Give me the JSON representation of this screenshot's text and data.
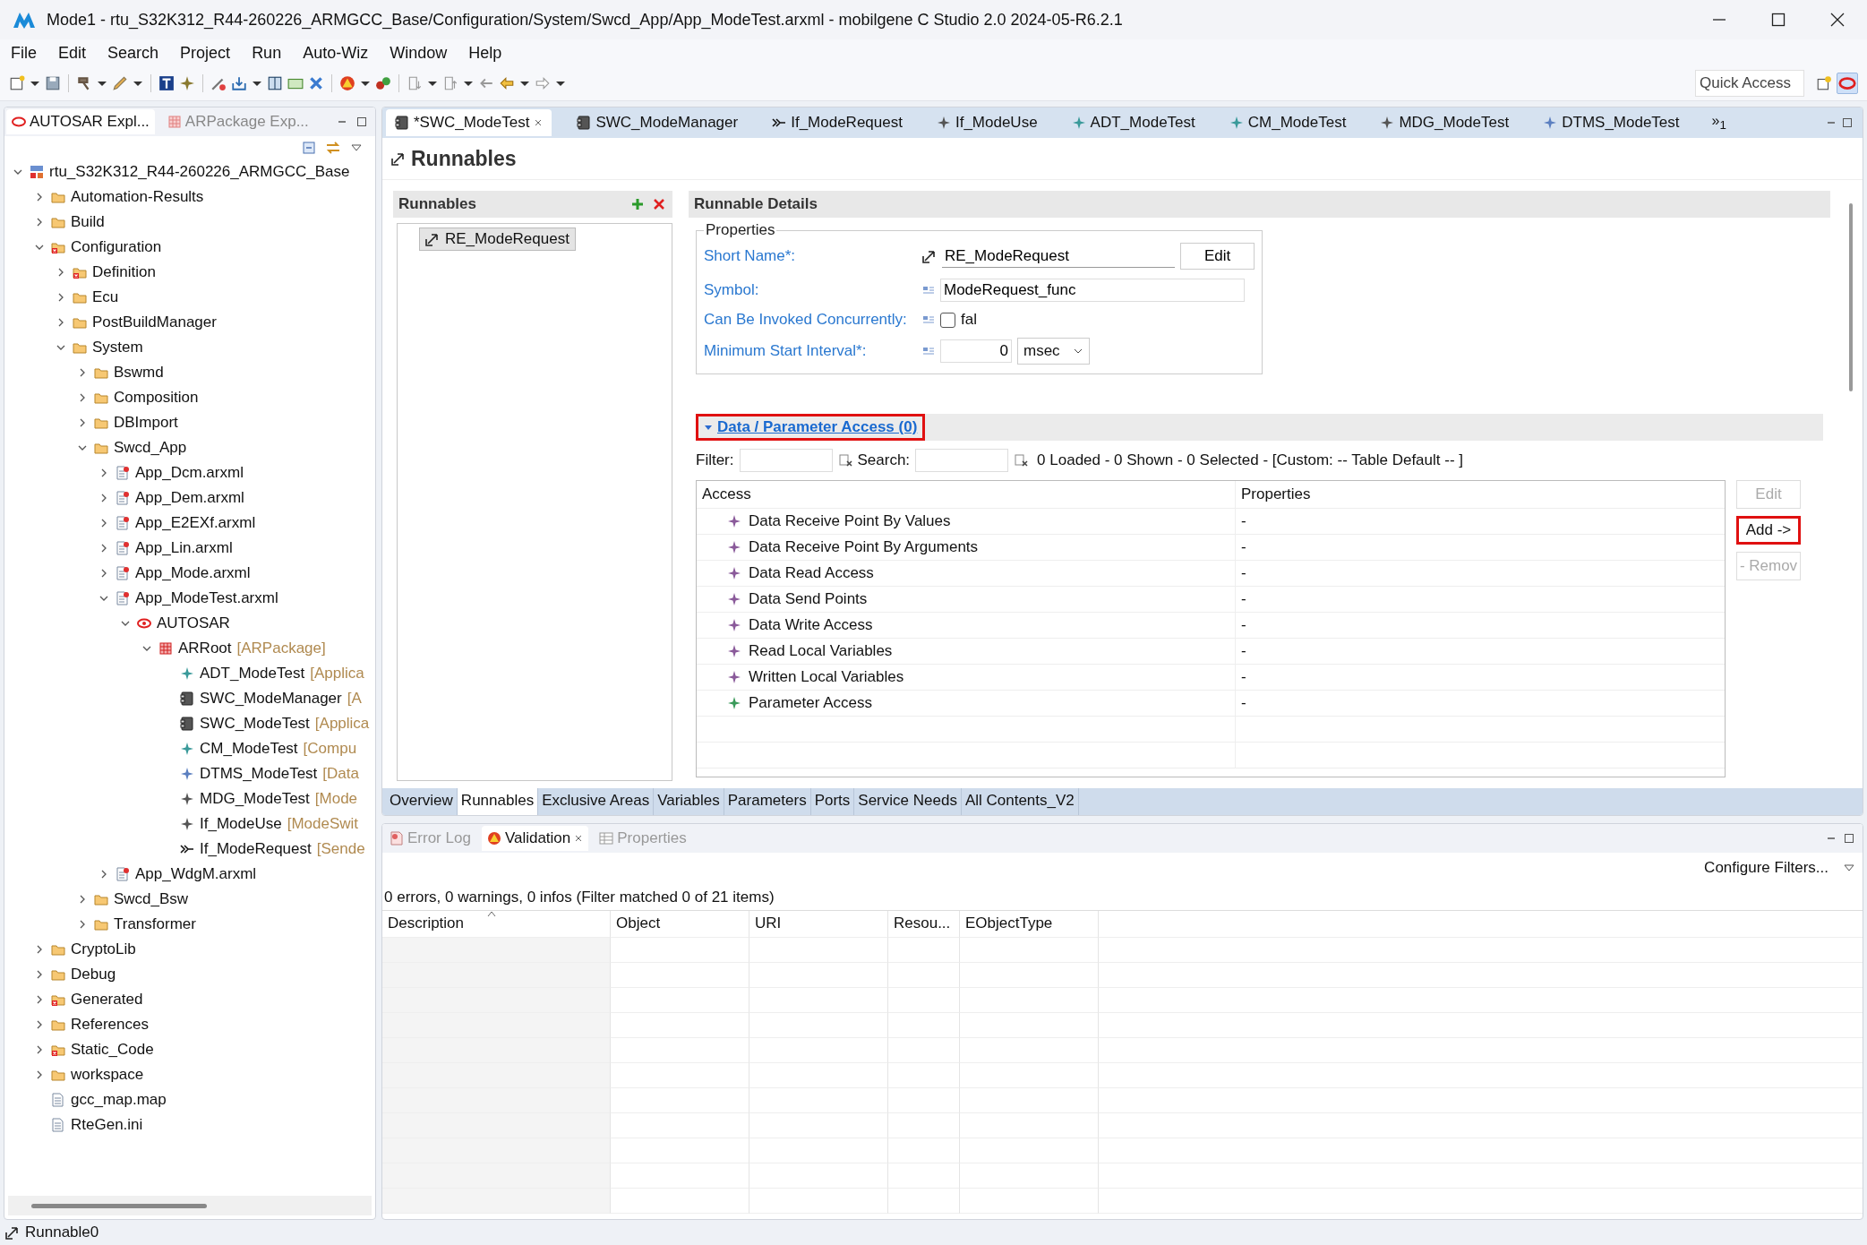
{
  "window": {
    "title": "Mode1 - rtu_S32K312_R44-260226_ARMGCC_Base/Configuration/System/Swcd_App/App_ModeTest.arxml - mobilgene C Studio 2.0 2024-05-R6.2.1"
  },
  "menu": [
    "File",
    "Edit",
    "Search",
    "Project",
    "Run",
    "Auto-Wiz",
    "Window",
    "Help"
  ],
  "quick_access": {
    "placeholder": "Quick Access"
  },
  "explorer": {
    "tabs": [
      {
        "label": "AUTOSAR Expl...",
        "selected": true
      },
      {
        "label": "ARPackage Exp...",
        "selected": false
      }
    ],
    "tree": [
      {
        "label": "rtu_S32K312_R44-260226_ARMGCC_Base",
        "kind": "project",
        "expanded": true,
        "children": [
          {
            "label": "Automation-Results",
            "kind": "folder",
            "expanded": false
          },
          {
            "label": "Build",
            "kind": "folder",
            "expanded": false
          },
          {
            "label": "Configuration",
            "kind": "folder-error",
            "expanded": true,
            "children": [
              {
                "label": "Definition",
                "kind": "folder-error",
                "expanded": false
              },
              {
                "label": "Ecu",
                "kind": "folder",
                "expanded": false
              },
              {
                "label": "PostBuildManager",
                "kind": "folder",
                "expanded": false
              },
              {
                "label": "System",
                "kind": "folder",
                "expanded": true,
                "children": [
                  {
                    "label": "Bswmd",
                    "kind": "folder",
                    "expanded": false
                  },
                  {
                    "label": "Composition",
                    "kind": "folder",
                    "expanded": false
                  },
                  {
                    "label": "DBImport",
                    "kind": "folder",
                    "expanded": false
                  },
                  {
                    "label": "Swcd_App",
                    "kind": "folder",
                    "expanded": true,
                    "children": [
                      {
                        "label": "App_Dcm.arxml",
                        "kind": "arxml",
                        "expanded": false
                      },
                      {
                        "label": "App_Dem.arxml",
                        "kind": "arxml",
                        "expanded": false
                      },
                      {
                        "label": "App_E2EXf.arxml",
                        "kind": "arxml",
                        "expanded": false
                      },
                      {
                        "label": "App_Lin.arxml",
                        "kind": "arxml",
                        "expanded": false
                      },
                      {
                        "label": "App_Mode.arxml",
                        "kind": "arxml",
                        "expanded": false
                      },
                      {
                        "label": "App_ModeTest.arxml",
                        "kind": "arxml",
                        "expanded": true,
                        "children": [
                          {
                            "label": "AUTOSAR",
                            "kind": "autosar",
                            "expanded": true,
                            "children": [
                              {
                                "label": "ARRoot",
                                "suffix": "[ARPackage]",
                                "kind": "package",
                                "expanded": true,
                                "children": [
                                  {
                                    "label": "ADT_ModeTest",
                                    "suffix": "[Applica",
                                    "kind": "type"
                                  },
                                  {
                                    "label": "SWC_ModeManager",
                                    "suffix": "[A",
                                    "kind": "component"
                                  },
                                  {
                                    "label": "SWC_ModeTest",
                                    "suffix": "[Applica",
                                    "kind": "component"
                                  },
                                  {
                                    "label": "CM_ModeTest",
                                    "suffix": "[Compu",
                                    "kind": "type"
                                  },
                                  {
                                    "label": "DTMS_ModeTest",
                                    "suffix": "[Data",
                                    "kind": "mapping"
                                  },
                                  {
                                    "label": "MDG_ModeTest",
                                    "suffix": "[Mode",
                                    "kind": "mode"
                                  },
                                  {
                                    "label": "If_ModeUse",
                                    "suffix": "[ModeSwit",
                                    "kind": "mode"
                                  },
                                  {
                                    "label": "If_ModeRequest",
                                    "suffix": "[Sende",
                                    "kind": "interface"
                                  }
                                ]
                              }
                            ]
                          }
                        ]
                      },
                      {
                        "label": "App_WdgM.arxml",
                        "kind": "arxml",
                        "expanded": false
                      }
                    ]
                  },
                  {
                    "label": "Swcd_Bsw",
                    "kind": "folder",
                    "expanded": false
                  },
                  {
                    "label": "Transformer",
                    "kind": "folder",
                    "expanded": false
                  }
                ]
              }
            ]
          },
          {
            "label": "CryptoLib",
            "kind": "folder",
            "expanded": false
          },
          {
            "label": "Debug",
            "kind": "folder",
            "expanded": false
          },
          {
            "label": "Generated",
            "kind": "folder-error",
            "expanded": false
          },
          {
            "label": "References",
            "kind": "folder",
            "expanded": false
          },
          {
            "label": "Static_Code",
            "kind": "folder-error",
            "expanded": false
          },
          {
            "label": "workspace",
            "kind": "folder",
            "expanded": false
          },
          {
            "label": "gcc_map.map",
            "kind": "file"
          },
          {
            "label": "RteGen.ini",
            "kind": "file"
          }
        ]
      }
    ]
  },
  "editor": {
    "tabs": [
      {
        "label": "*SWC_ModeTest",
        "kind": "component",
        "selected": true
      },
      {
        "label": "SWC_ModeManager",
        "kind": "component",
        "selected": false
      },
      {
        "label": "If_ModeRequest",
        "kind": "interface",
        "selected": false
      },
      {
        "label": "If_ModeUse",
        "kind": "mode",
        "selected": false
      },
      {
        "label": "ADT_ModeTest",
        "kind": "type",
        "selected": false
      },
      {
        "label": "CM_ModeTest",
        "kind": "type",
        "selected": false
      },
      {
        "label": "MDG_ModeTest",
        "kind": "mode",
        "selected": false
      },
      {
        "label": "DTMS_ModeTest",
        "kind": "mapping",
        "selected": false
      }
    ],
    "overflow": "»$_{1}$",
    "title": "Runnables",
    "runnables": {
      "title": "Runnables",
      "items": [
        {
          "label": "RE_ModeRequest",
          "selected": true
        }
      ]
    },
    "details": {
      "title": "Runnable Details",
      "properties": {
        "title": "Properties",
        "short_name": {
          "label": "Short Name*:",
          "value": "RE_ModeRequest",
          "button": "Edit"
        },
        "symbol": {
          "label": "Symbol:",
          "value": "ModeRequest_func"
        },
        "concurrent": {
          "label": "Can Be Invoked Concurrently:",
          "checked": false,
          "value": "fal"
        },
        "interval": {
          "label": "Minimum Start Interval*:",
          "value": "0",
          "unit": "msec"
        }
      },
      "access": {
        "title": "Data / Parameter Access (0)",
        "expanded": true,
        "highlighted": true,
        "filter_label": "Filter:",
        "search_label": "Search:",
        "summary": "0 Loaded - 0 Shown - 0 Selected -  [Custom: -- Table Default -- ]",
        "columns": [
          "Access",
          "Properties"
        ],
        "rows": [
          {
            "access": "Data Receive Point By Values",
            "properties": "-",
            "kind": "data"
          },
          {
            "access": "Data Receive Point By Arguments",
            "properties": "-",
            "kind": "data"
          },
          {
            "access": "Data Read Access",
            "properties": "-",
            "kind": "data"
          },
          {
            "access": "Data Send Points",
            "properties": "-",
            "kind": "data"
          },
          {
            "access": "Data Write Access",
            "properties": "-",
            "kind": "data"
          },
          {
            "access": "Read Local Variables",
            "properties": "-",
            "kind": "data"
          },
          {
            "access": "Written Local Variables",
            "properties": "-",
            "kind": "data"
          },
          {
            "access": "Parameter Access",
            "properties": "-",
            "kind": "parameter"
          }
        ],
        "buttons": [
          {
            "label": "Edit",
            "disabled": true,
            "highlighted": false
          },
          {
            "label": "Add ->",
            "disabled": false,
            "highlighted": true
          },
          {
            "label": "- Remov",
            "disabled": true,
            "highlighted": false
          }
        ]
      }
    },
    "page_tabs": [
      {
        "label": "Overview",
        "selected": false
      },
      {
        "label": "Runnables",
        "selected": true
      },
      {
        "label": "Exclusive Areas",
        "selected": false
      },
      {
        "label": "Variables",
        "selected": false
      },
      {
        "label": "Parameters",
        "selected": false
      },
      {
        "label": "Ports",
        "selected": false
      },
      {
        "label": "Service Needs",
        "selected": false
      },
      {
        "label": "All Contents_V2",
        "selected": false
      }
    ]
  },
  "validation": {
    "tabs": [
      {
        "label": "Error Log",
        "kind": "log",
        "selected": false
      },
      {
        "label": "Validation",
        "kind": "validation",
        "selected": true
      },
      {
        "label": "Properties",
        "kind": "properties",
        "selected": false
      }
    ],
    "configure": "Configure Filters...",
    "summary": "0 errors, 0 warnings, 0 infos (Filter matched 0 of 21 items)",
    "columns": [
      "Description",
      "Object",
      "URI",
      "Resou...",
      "EObjectType"
    ]
  },
  "status_bar": {
    "text": "Runnable0"
  }
}
